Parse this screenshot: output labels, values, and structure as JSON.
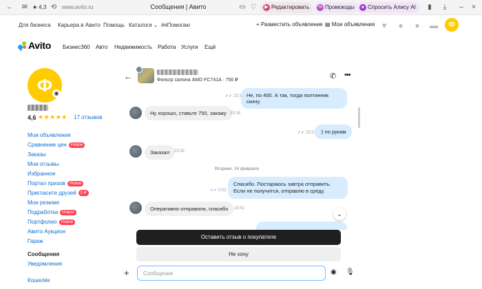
{
  "browser": {
    "rating": "4,3",
    "url": "www.avito.ru",
    "title": "Сообщения | Авито",
    "pill_edit": "Редактировать",
    "pill_promo": "Промокоды",
    "pill_alice": "Спросить Алису AI"
  },
  "topnav": {
    "links": [
      "Для бизнеса",
      "Карьера в Авито",
      "Помощь",
      "Каталоги",
      "#яПомогаю"
    ],
    "post_ad": "Разместить объявление",
    "my_ads": "Мои объявления",
    "avatar_letter": "Ф"
  },
  "brand": {
    "logo": "Avito"
  },
  "catnav": [
    "Бизнес360",
    "Авто",
    "Недвижимость",
    "Работа",
    "Услуги",
    "Ещё"
  ],
  "profile": {
    "avatar_letter": "Ф",
    "score": "4,6",
    "stars": "★★★★★",
    "reviews": "17 отзывов"
  },
  "sidebar": {
    "items": [
      {
        "label": "Мои объявления",
        "badge": ""
      },
      {
        "label": "Сравнение цен",
        "badge": "Новое"
      },
      {
        "label": "Заказы",
        "badge": ""
      },
      {
        "label": "Мои отзывы",
        "badge": ""
      },
      {
        "label": "Избранное",
        "badge": ""
      },
      {
        "label": "Портал призов",
        "badge": "Новое"
      },
      {
        "label": "Пригласите друзей",
        "badge": "0 ₽"
      },
      {
        "label": "Мои резюме",
        "badge": ""
      },
      {
        "label": "Подработка",
        "badge": "Новое"
      },
      {
        "label": "Портфолио",
        "badge": "Новое"
      },
      {
        "label": "Авито Аукцион",
        "badge": ""
      },
      {
        "label": "Гараж",
        "badge": ""
      }
    ],
    "section_messages": "Сообщения",
    "notifications": "Уведомления",
    "wallet": "Кошелёк"
  },
  "chat": {
    "item_title": "Фильтр салона AMD FC741A · 750 ₽",
    "date_separator": "Вторник, 24 февраля",
    "messages": [
      {
        "dir": "out",
        "text": "Не, по 400. А так, тогда полтинник скину.",
        "time": "23:14"
      },
      {
        "dir": "in",
        "text": "Ну хорошо, ставьте 750, закажу",
        "time": "23:16"
      },
      {
        "dir": "out",
        "text": ":) по рукам",
        "time": "23:23"
      },
      {
        "dir": "in",
        "text": "Заказал",
        "time": "23:32"
      },
      {
        "dir": "out",
        "text": "Спасибо. Постараюсь завтра отправить. Если не получится, отправлю в среду.",
        "time": "0:02"
      },
      {
        "dir": "in",
        "text": "Оперативно отправили, спасибо",
        "time": "15:51"
      }
    ]
  },
  "actions": {
    "review_button": "Оставить отзыв о покупателе",
    "no_button": "Не хочу"
  },
  "compose": {
    "placeholder": "Сообщение"
  }
}
